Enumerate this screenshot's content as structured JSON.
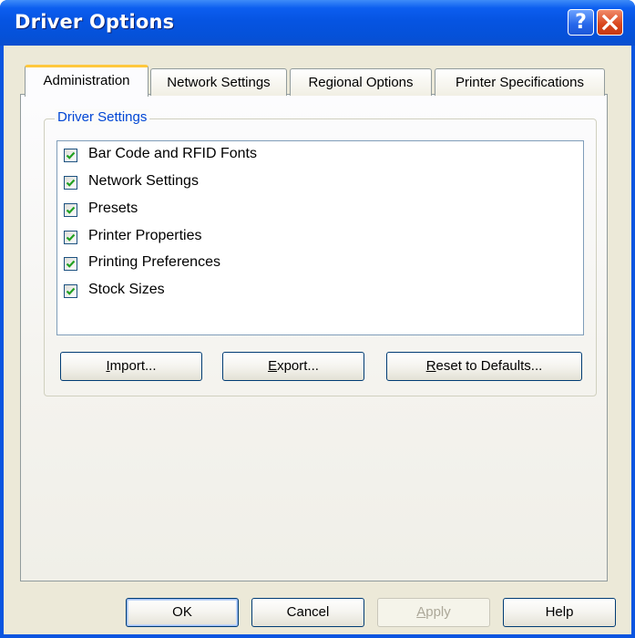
{
  "window": {
    "title": "Driver Options"
  },
  "tabs": [
    {
      "label": "Administration",
      "active": true
    },
    {
      "label": "Network Settings",
      "active": false
    },
    {
      "label": "Regional Options",
      "active": false
    },
    {
      "label": "Printer Specifications",
      "active": false
    }
  ],
  "driver_settings": {
    "legend": "Driver Settings",
    "items": [
      {
        "label": "Bar Code and RFID Fonts",
        "checked": true
      },
      {
        "label": "Network Settings",
        "checked": true
      },
      {
        "label": "Presets",
        "checked": true
      },
      {
        "label": "Printer Properties",
        "checked": true
      },
      {
        "label": "Printing Preferences",
        "checked": true
      },
      {
        "label": "Stock Sizes",
        "checked": true
      }
    ],
    "buttons": {
      "import": {
        "mnemonic": "I",
        "rest": "mport..."
      },
      "export": {
        "mnemonic": "E",
        "rest": "xport..."
      },
      "reset": {
        "mnemonic": "R",
        "rest": "eset to Defaults..."
      }
    }
  },
  "footer": {
    "ok": "OK",
    "cancel": "Cancel",
    "apply": {
      "mnemonic": "A",
      "rest": "pply"
    },
    "help": "Help"
  },
  "colors": {
    "title_bar": "#0654e2",
    "group_legend": "#0046d5",
    "active_tab_accent": "#ffc83c",
    "checkmark": "#21a121",
    "dialog_face": "#ece9d8"
  },
  "icons": {
    "help": "question-mark-icon",
    "close": "close-x-icon",
    "check": "checkmark-icon"
  }
}
